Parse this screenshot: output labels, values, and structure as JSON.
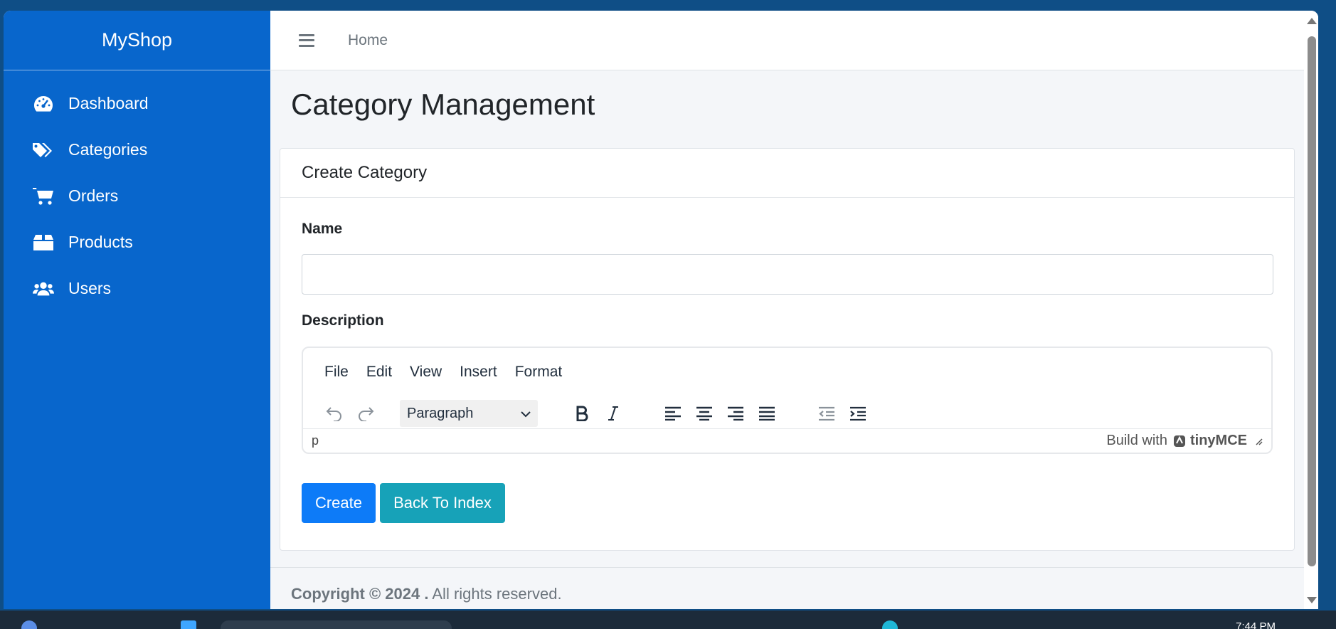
{
  "sidebar": {
    "brand": "MyShop",
    "items": [
      {
        "label": "Dashboard",
        "icon": "dashboard-gauge-icon"
      },
      {
        "label": "Categories",
        "icon": "tags-icon"
      },
      {
        "label": "Orders",
        "icon": "shopping-cart-icon"
      },
      {
        "label": "Products",
        "icon": "box-icon"
      },
      {
        "label": "Users",
        "icon": "users-icon"
      }
    ]
  },
  "topbar": {
    "menu_icon": "hamburger-icon",
    "home_link": "Home"
  },
  "page": {
    "title": "Category Management"
  },
  "card": {
    "header": "Create Category",
    "name_label": "Name",
    "name_value": "",
    "description_label": "Description"
  },
  "editor": {
    "menu": [
      "File",
      "Edit",
      "View",
      "Insert",
      "Format"
    ],
    "block_format": "Paragraph",
    "status_path": "p",
    "branding_prefix": "Build with",
    "branding_name": "tinyMCE",
    "toolbar_icons": [
      "undo-icon",
      "redo-icon",
      "bold-icon",
      "italic-icon",
      "align-left-icon",
      "align-center-icon",
      "align-right-icon",
      "align-justify-icon",
      "outdent-icon",
      "indent-icon"
    ]
  },
  "buttons": {
    "create": "Create",
    "back": "Back To Index"
  },
  "footer": {
    "copyright": "Copyright © 2024 .",
    "rights": " All rights reserved."
  },
  "taskbar": {
    "clock": "7:44 PM"
  },
  "colors": {
    "sidebar_bg": "#0866cc",
    "primary": "#0d7bf8",
    "info": "#17a2b8",
    "desktop_bg": "#0f4e86"
  }
}
